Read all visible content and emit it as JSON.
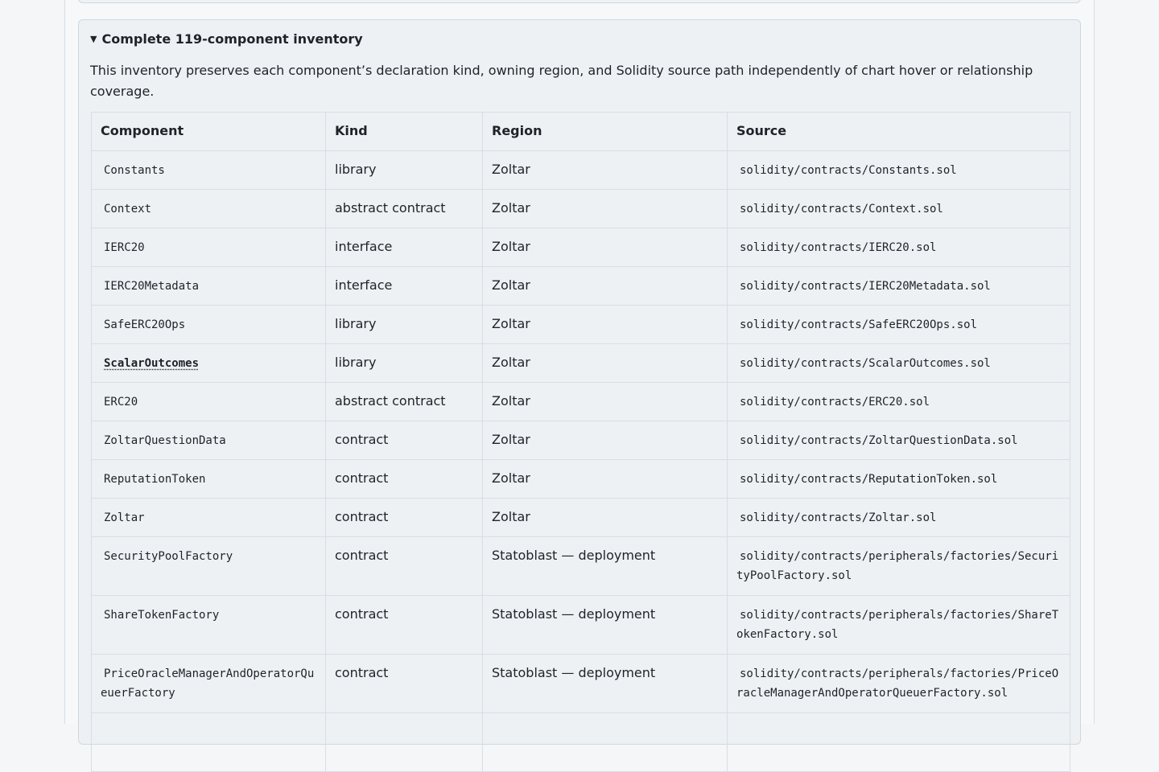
{
  "section": {
    "title": "Complete 119-component inventory",
    "description": "This inventory preserves each component’s declaration kind, owning region, and Solidity source path independently of chart hover or relationship coverage."
  },
  "table": {
    "headers": [
      "Component",
      "Kind",
      "Region",
      "Source"
    ],
    "rows": [
      {
        "component": "Constants",
        "kind": "library",
        "region": "Zoltar",
        "source": "solidity/contracts/Constants.sol"
      },
      {
        "component": "Context",
        "kind": "abstract contract",
        "region": "Zoltar",
        "source": "solidity/contracts/Context.sol"
      },
      {
        "component": "IERC20",
        "kind": "interface",
        "region": "Zoltar",
        "source": "solidity/contracts/IERC20.sol"
      },
      {
        "component": "IERC20Metadata",
        "kind": "interface",
        "region": "Zoltar",
        "source": "solidity/contracts/IERC20Metadata.sol"
      },
      {
        "component": "SafeERC20Ops",
        "kind": "library",
        "region": "Zoltar",
        "source": "solidity/contracts/SafeERC20Ops.sol"
      },
      {
        "component": "ScalarOutcomes",
        "kind": "library",
        "region": "Zoltar",
        "source": "solidity/contracts/ScalarOutcomes.sol"
      },
      {
        "component": "ERC20",
        "kind": "abstract contract",
        "region": "Zoltar",
        "source": "solidity/contracts/ERC20.sol"
      },
      {
        "component": "ZoltarQuestionData",
        "kind": "contract",
        "region": "Zoltar",
        "source": "solidity/contracts/ZoltarQuestionData.sol"
      },
      {
        "component": "ReputationToken",
        "kind": "contract",
        "region": "Zoltar",
        "source": "solidity/contracts/ReputationToken.sol"
      },
      {
        "component": "Zoltar",
        "kind": "contract",
        "region": "Zoltar",
        "source": "solidity/contracts/Zoltar.sol"
      },
      {
        "component": "SecurityPoolFactory",
        "kind": "contract",
        "region": "Statoblast — deployment",
        "source": "solidity/contracts/peripherals/factories/SecurityPoolFactory.sol"
      },
      {
        "component": "ShareTokenFactory",
        "kind": "contract",
        "region": "Statoblast — deployment",
        "source": "solidity/contracts/peripherals/factories/ShareTokenFactory.sol"
      },
      {
        "component": "PriceOracleManagerAndOperatorQueuerFactory",
        "kind": "contract",
        "region": "Statoblast — deployment",
        "source": "solidity/contracts/peripherals/factories/PriceOracleManagerAndOperatorQueuerFactory.sol"
      }
    ]
  }
}
